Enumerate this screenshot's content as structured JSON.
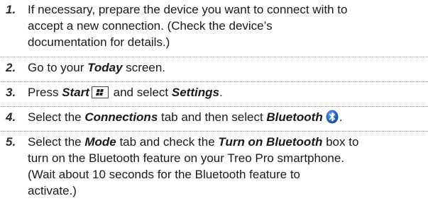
{
  "steps": [
    {
      "number": "1.",
      "lines": [
        "If necessary, prepare the device you want to connect with to",
        "accept a new connection. (Check the device’s",
        "documentation for details.)"
      ]
    },
    {
      "number": "2.",
      "pre": "Go to your ",
      "em": "Today",
      "post": " screen."
    },
    {
      "number": "3.",
      "pre": "Press ",
      "em1": "Start",
      "key_icon": "windows-start-key-icon",
      "mid": " and select ",
      "em2": "Settings",
      "post": "."
    },
    {
      "number": "4.",
      "pre": "Select the ",
      "em1": "Connections",
      "mid": " tab and then select ",
      "em2": "Bluetooth",
      "icon": "bluetooth-icon",
      "post": "."
    },
    {
      "number": "5.",
      "pre": "Select the ",
      "em1": "Mode",
      "mid": " tab and check the ",
      "em2": "Turn on Bluetooth",
      "post": " box to",
      "lines": [
        "turn on the Bluetooth feature on your Treo Pro smartphone.",
        "(Wait about 10 seconds for the Bluetooth feature to",
        "activate.)"
      ]
    }
  ],
  "colors": {
    "text": "#1a1a1a",
    "bluetooth_blue": "#1f5fbf",
    "divider": "#9a9a9a"
  }
}
